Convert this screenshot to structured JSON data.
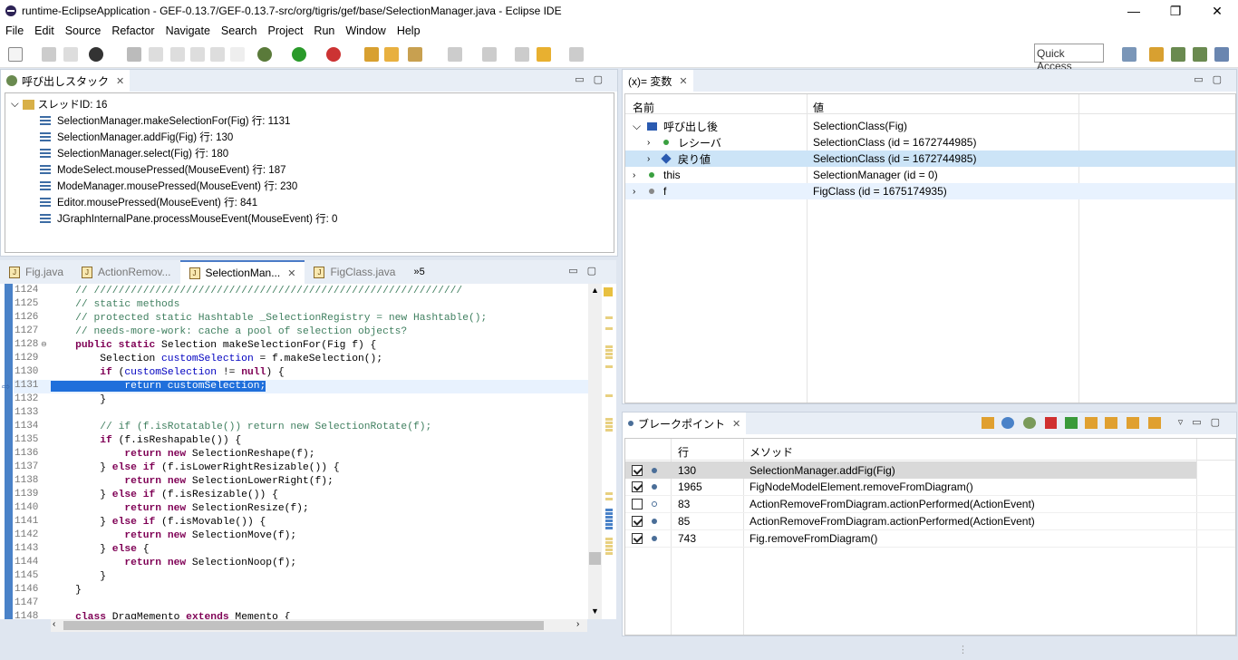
{
  "window": {
    "title": "runtime-EclipseApplication - GEF-0.13.7/GEF-0.13.7-src/org/tigris/gef/base/SelectionManager.java - Eclipse IDE",
    "min": "—",
    "max": "❐",
    "close": "✕"
  },
  "menu": [
    "File",
    "Edit",
    "Source",
    "Refactor",
    "Navigate",
    "Search",
    "Project",
    "Run",
    "Window",
    "Help"
  ],
  "quick_access": "Quick Access",
  "callstack": {
    "tab": "呼び出しスタック",
    "thread": "スレッドID: 16",
    "frames": [
      "SelectionManager.makeSelectionFor(Fig) 行: 1131",
      "SelectionManager.addFig(Fig) 行: 130",
      "SelectionManager.select(Fig) 行: 180",
      "ModeSelect.mousePressed(MouseEvent) 行: 187",
      "ModeManager.mousePressed(MouseEvent) 行: 230",
      "Editor.mousePressed(MouseEvent) 行: 841",
      "JGraphInternalPane.processMouseEvent(MouseEvent) 行: 0"
    ]
  },
  "variables": {
    "tab": "(x)= 変数",
    "col_name": "名前",
    "col_value": "値",
    "rows": [
      {
        "name": "呼び出し後",
        "value": "SelectionClass(Fig)"
      },
      {
        "name": "レシーバ",
        "value": "SelectionClass (id = 1672744985)"
      },
      {
        "name": "戻り値",
        "value": "SelectionClass (id = 1672744985)"
      },
      {
        "name": "this",
        "value": "SelectionManager (id = 0)"
      },
      {
        "name": "f",
        "value": "FigClass (id = 1675174935)"
      }
    ]
  },
  "editor": {
    "tabs": [
      "Fig.java",
      "ActionRemov...",
      "SelectionMan...",
      "FigClass.java"
    ],
    "overflow": "»5",
    "lines": [
      "1124",
      "1125",
      "1126",
      "1127",
      "1128",
      "1129",
      "1130",
      "1131",
      "1132",
      "1133",
      "1134",
      "1135",
      "1136",
      "1137",
      "1138",
      "1139",
      "1140",
      "1141",
      "1142",
      "1143",
      "1144",
      "1145",
      "1146",
      "1147",
      "1148"
    ]
  },
  "breakpoints": {
    "tab": "ブレークポイント",
    "col_line": "行",
    "col_method": "メソッド",
    "rows": [
      {
        "checked": true,
        "line": "130",
        "method": "SelectionManager.addFig(Fig)"
      },
      {
        "checked": true,
        "line": "1965",
        "method": "FigNodeModelElement.removeFromDiagram()"
      },
      {
        "checked": false,
        "line": "83",
        "method": "ActionRemoveFromDiagram.actionPerformed(ActionEvent)"
      },
      {
        "checked": true,
        "line": "85",
        "method": "ActionRemoveFromDiagram.actionPerformed(ActionEvent)"
      },
      {
        "checked": true,
        "line": "743",
        "method": "Fig.removeFromDiagram()"
      }
    ]
  }
}
